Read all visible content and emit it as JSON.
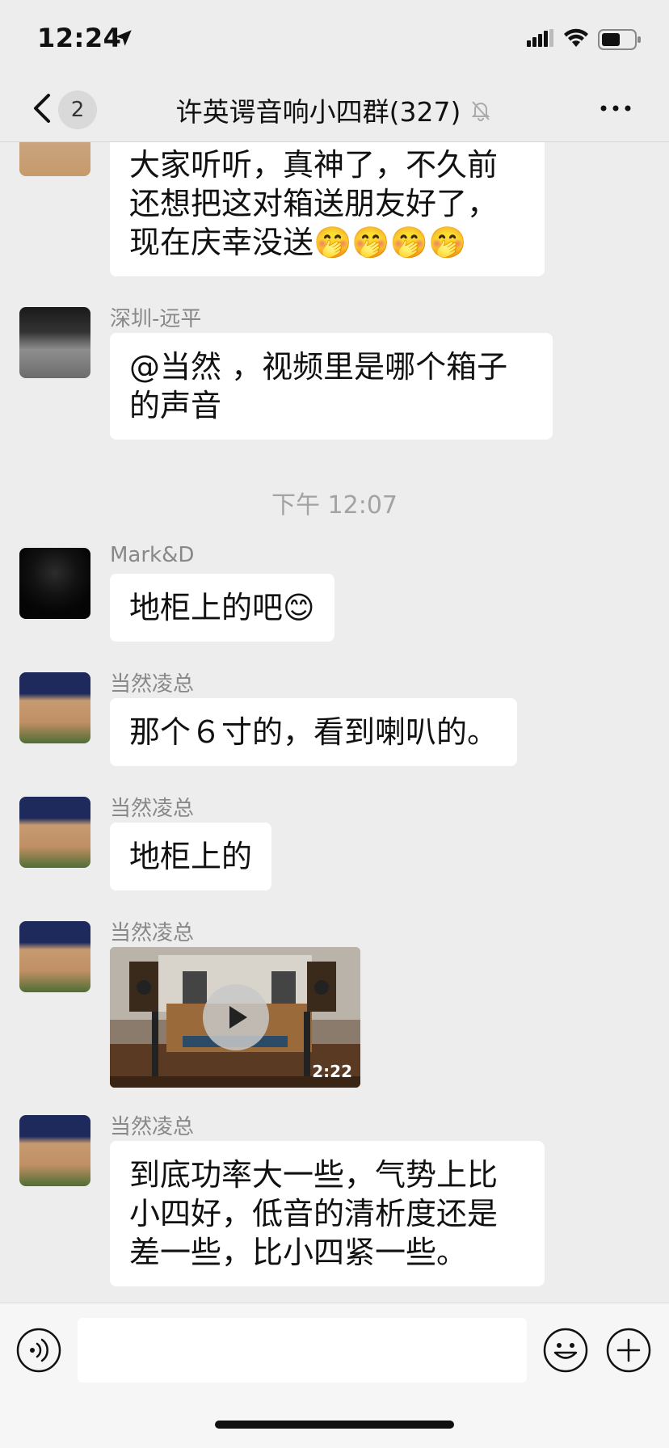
{
  "status_bar": {
    "time": "12:24"
  },
  "header": {
    "back_badge": "2",
    "title": "许英谔音响小四群(327)"
  },
  "messages": [
    {
      "text": "大家听听，真神了，不久前还想把这对箱送朋友好了，现在庆幸没送🤭🤭🤭🤭"
    },
    {
      "sender": "深圳-远平",
      "text": "@当然 ，视频里是哪个箱子的声音"
    },
    {
      "sender": "Mark&D",
      "text": "地柜上的吧😊"
    },
    {
      "sender": "当然凌总",
      "text": "那个６寸的，看到喇叭的。"
    },
    {
      "sender": "当然凌总",
      "text": "地柜上的"
    },
    {
      "sender": "当然凌总",
      "video_duration": "2:22"
    },
    {
      "sender": "当然凌总",
      "text": "到底功率大一些，气势上比小四好，低音的清析度还是差一些，比小四紧一些。"
    }
  ],
  "timestamp": "下午 12:07",
  "input": {
    "value": ""
  },
  "icons": {
    "back": "chevron-left-icon",
    "mute": "bell-slash-icon",
    "more": "ellipsis-icon",
    "voice": "voice-icon",
    "emoji": "smiley-icon",
    "plus": "plus-circle-icon"
  },
  "colors": {
    "background": "#ededed",
    "bubble": "#ffffff",
    "sender": "#888888",
    "timestamp": "#a3a3a3"
  }
}
